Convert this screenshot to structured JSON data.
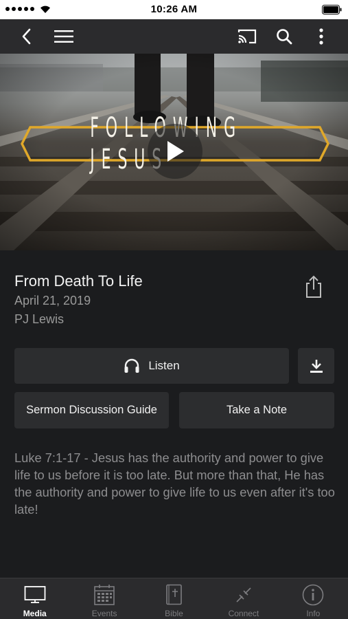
{
  "status_bar": {
    "time": "10:26 AM"
  },
  "nav_bar": {
    "icons": [
      "chevron-left-icon",
      "menu-icon",
      "cast-icon",
      "search-icon",
      "more-vertical-icon"
    ]
  },
  "hero": {
    "series_title": "FOLLOWING JESUS",
    "frame_color": "#e0a82a"
  },
  "sermon": {
    "title": "From Death To Life",
    "date": "April 21, 2019",
    "speaker": "PJ Lewis",
    "description": "Luke 7:1-17 - Jesus has the authority and power to give life to us before it is too late. But more than that, He has the authority and power to give life to us even after it's too late!"
  },
  "actions": {
    "listen_label": "Listen",
    "guide_label": "Sermon Discussion Guide",
    "note_label": "Take a Note"
  },
  "tab_bar": {
    "tabs": [
      {
        "label": "Media",
        "icon": "tv-icon",
        "active": true
      },
      {
        "label": "Events",
        "icon": "calendar-icon",
        "active": false
      },
      {
        "label": "Bible",
        "icon": "bible-icon",
        "active": false
      },
      {
        "label": "Connect",
        "icon": "connect-icon",
        "active": false
      },
      {
        "label": "Info",
        "icon": "info-icon",
        "active": false
      }
    ]
  },
  "colors": {
    "nav_background": "#2b2b2d",
    "content_background": "#1b1c1e",
    "button_background": "#2c2d2f"
  }
}
